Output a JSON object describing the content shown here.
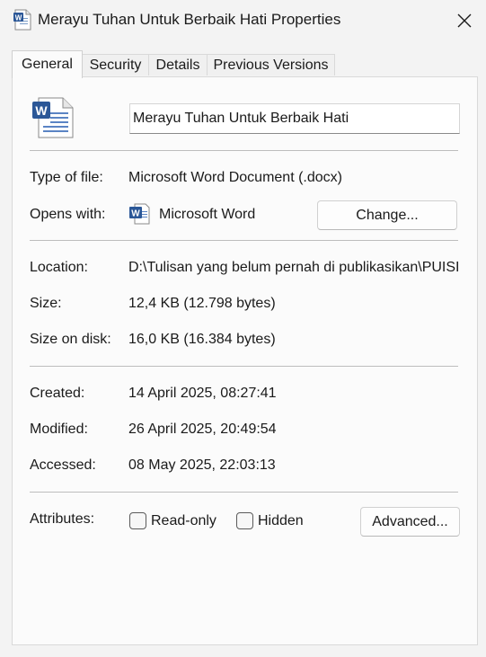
{
  "window": {
    "title": "Merayu Tuhan Untuk Berbaik Hati Properties",
    "title_icon": "word-document-icon",
    "close_icon": "close-icon"
  },
  "tabs": [
    {
      "label": "General",
      "active": true
    },
    {
      "label": "Security",
      "active": false
    },
    {
      "label": "Details",
      "active": false
    },
    {
      "label": "Previous Versions",
      "active": false
    }
  ],
  "general": {
    "file_name": "Merayu Tuhan Untuk Berbaik Hati",
    "type_of_file_label": "Type of file:",
    "type_of_file": "Microsoft Word Document (.docx)",
    "opens_with_label": "Opens with:",
    "opens_with": "Microsoft Word",
    "change_button": "Change...",
    "location_label": "Location:",
    "location": "D:\\Tulisan yang belum pernah di publikasikan\\PUISI",
    "size_label": "Size:",
    "size": "12,4 KB (12.798 bytes)",
    "size_on_disk_label": "Size on disk:",
    "size_on_disk": "16,0 KB (16.384 bytes)",
    "created_label": "Created:",
    "created": "14 April 2025, 08:27:41",
    "modified_label": "Modified:",
    "modified": "26 April 2025, 20:49:54",
    "accessed_label": "Accessed:",
    "accessed": "08 May 2025, 22:03:13",
    "attributes_label": "Attributes:",
    "readonly_label": "Read-only",
    "readonly_checked": false,
    "hidden_label": "Hidden",
    "hidden_checked": false,
    "advanced_button": "Advanced..."
  },
  "colors": {
    "word_blue": "#2b5797",
    "window_bg": "#f3f3f3",
    "panel_bg": "#fbfbfb"
  }
}
